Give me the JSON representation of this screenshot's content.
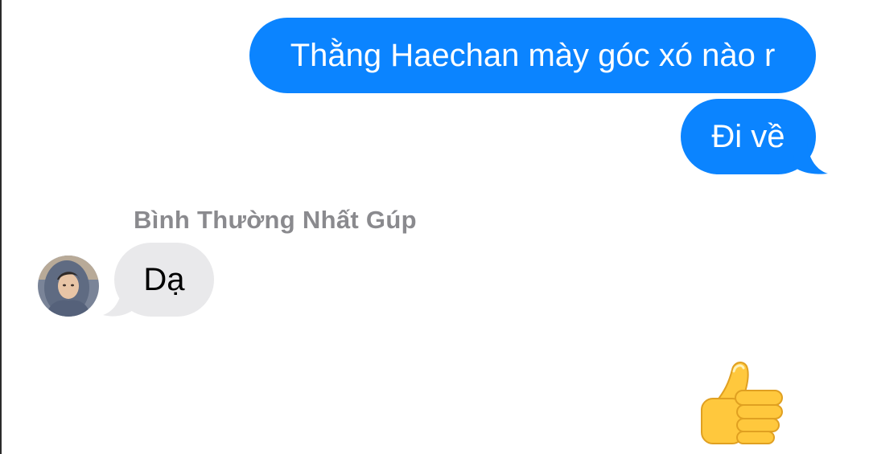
{
  "conversation": {
    "messages": [
      {
        "direction": "outgoing",
        "text": "Thằng Haechan mày góc xó nào r"
      },
      {
        "direction": "outgoing",
        "text": "Đi về"
      },
      {
        "direction": "incoming",
        "sender": "Bình Thường Nhất Gúp",
        "text": "Dạ"
      }
    ],
    "reaction": {
      "icon": "thumbs-up-icon"
    }
  },
  "colors": {
    "outgoing_bubble": "#0b84ff",
    "incoming_bubble": "#e9e9eb",
    "sender_name": "#8a8a8e",
    "thumbs_up": "#ffc83d"
  }
}
